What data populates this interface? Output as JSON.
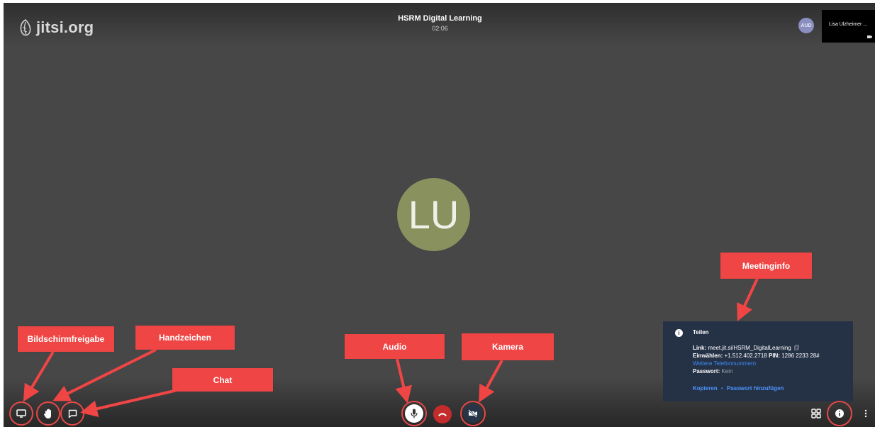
{
  "header": {
    "logo_text": "jitsi.org",
    "meeting_title": "HSRM Digital Learning",
    "timer": "02:06",
    "audience_avatar_initials": "AUD",
    "self_view_name": "Lisa Ulzheimer ..."
  },
  "main": {
    "participant_initials": "LU",
    "participant_avatar_color": "#89915e"
  },
  "callouts": {
    "screen_share": "Bildschirmfreigabe",
    "raise_hand": "Handzeichen",
    "chat": "Chat",
    "audio": "Audio",
    "camera": "Kamera",
    "meeting_info": "Meetinginfo"
  },
  "info_panel": {
    "title": "Teilen",
    "link_label": "Link:",
    "link_value": "meet.jit.si/HSRM_DigitalLearning",
    "dial_label": "Einwählen:",
    "dial_value": "+1.512.402.2718",
    "pin_label": "PIN:",
    "pin_value": "1286 2233 28#",
    "more_numbers": "Weitere Telefonnummern",
    "password_label": "Passwort:",
    "password_value": "Kein",
    "copy_label": "Kopieren",
    "separator": "•",
    "add_password_label": "Passwort hinzufügen"
  },
  "toolbar": {
    "left": [
      "desktop-icon",
      "hand-icon",
      "chat-icon"
    ],
    "center": [
      "microphone-icon",
      "hangup-icon",
      "camera-off-icon"
    ],
    "right": [
      "tile-view-icon",
      "info-icon",
      "more-vertical-icon"
    ]
  },
  "colors": {
    "stage_background": "#474747",
    "callout_background": "#f04545",
    "highlight_ring": "#e74848",
    "hangup": "#c42b2b",
    "info_panel": "#253246",
    "link": "#3d8bf5"
  }
}
